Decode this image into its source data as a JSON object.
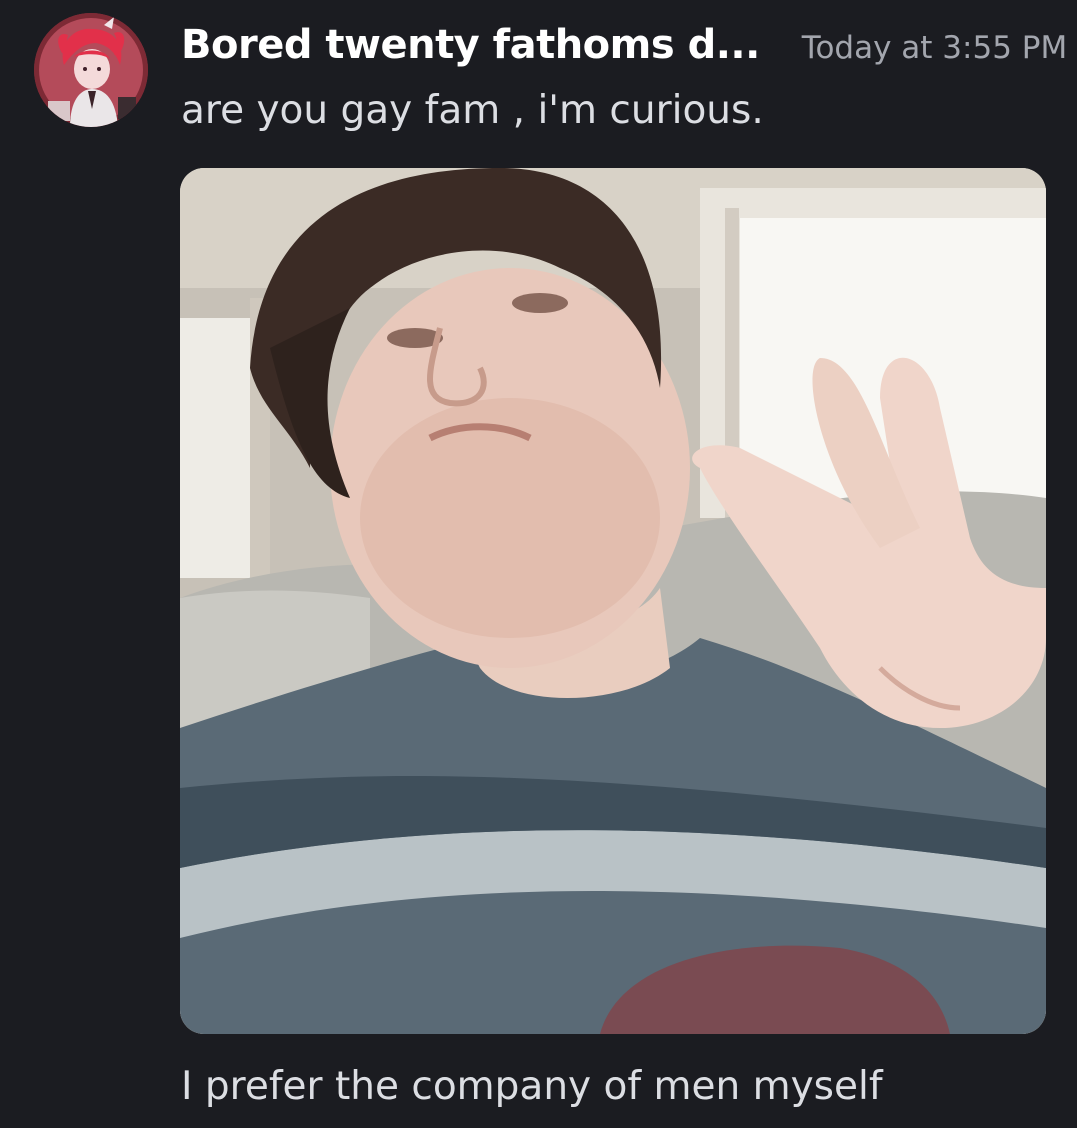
{
  "message": {
    "author": "Bored twenty fathoms d...",
    "timestamp": "Today at 3:55 PM",
    "text_lines": [
      "are you gay fam , i'm curious.",
      "I prefer the company of men myself"
    ],
    "avatar": {
      "icon": "user-avatar-icon",
      "background_color": "#8a2f3c"
    },
    "attachment": {
      "icon": "image-attachment-icon"
    }
  },
  "colors": {
    "background": "#1b1c21",
    "username": "#ffffff",
    "timestamp": "#a3a6ae",
    "message_text": "#dcdee3"
  }
}
